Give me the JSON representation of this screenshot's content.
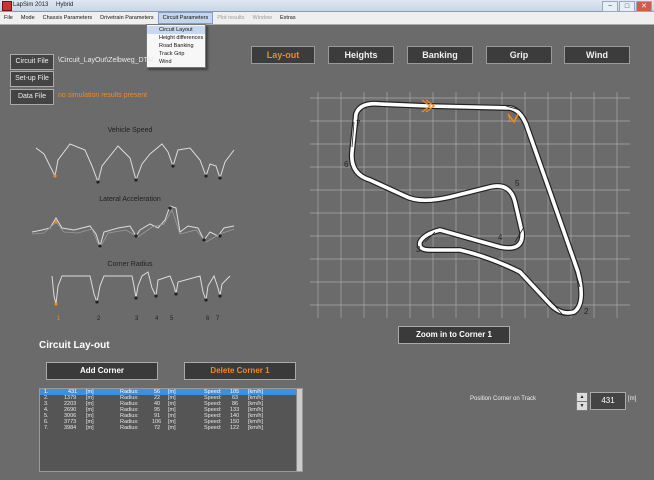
{
  "window": {
    "app_title": "LapSim 2013",
    "doc_title": "Hybrid",
    "minimize": "−",
    "maximize": "□",
    "close": "✕"
  },
  "menu": {
    "items": [
      {
        "label": "File",
        "state": "normal"
      },
      {
        "label": "Mode",
        "state": "normal"
      },
      {
        "label": "Chassis Parameters",
        "state": "normal"
      },
      {
        "label": "Drivetrain Parameters",
        "state": "normal"
      },
      {
        "label": "Circuit Parameters",
        "state": "active"
      },
      {
        "label": "Plot results",
        "state": "disabled"
      },
      {
        "label": "Window",
        "state": "disabled"
      },
      {
        "label": "Extras",
        "state": "normal"
      }
    ],
    "dropdown": [
      "Circuit Layout",
      "Height differences",
      "Road Banking",
      "Track Grip",
      "Wind"
    ],
    "dropdown_selected": 0
  },
  "files": {
    "circuit_btn": "Circuit File",
    "circuit_path": "\\Circuit_LayOut\\Zelbweg_DTM",
    "setup_btn": "Set-up File",
    "data_btn": "Data File",
    "data_status": "no simulation results present"
  },
  "tabs": [
    {
      "label": "Lay-out",
      "active": true
    },
    {
      "label": "Heights",
      "active": false
    },
    {
      "label": "Banking",
      "active": false
    },
    {
      "label": "Grip",
      "active": false
    },
    {
      "label": "Wind",
      "active": false
    }
  ],
  "charts": {
    "speed_title": "Vehicle Speed",
    "lat_title": "Lateral Acceleration",
    "radius_title": "Corner Radius",
    "corner_labels": [
      "1",
      "2",
      "3",
      "4",
      "5",
      "6",
      "7"
    ]
  },
  "track": {
    "corner_numbers": [
      "1",
      "2",
      "3",
      "4",
      "5",
      "6",
      "7"
    ],
    "line_color": "#ffffff",
    "edge_color": "#222222",
    "highlight_color": "#f08a1e"
  },
  "zoom_btn": "Zoom in to Corner 1",
  "section_title": "Circuit Lay-out",
  "add_corner": "Add Corner",
  "delete_corner": "Delete Corner 1",
  "corners": [
    {
      "n": "1.",
      "pos": "431",
      "pu": "[m]",
      "rl": "Radius:",
      "r": "56",
      "ru": "[m]",
      "sl": "Speed:",
      "s": "105",
      "su": "[km/h]"
    },
    {
      "n": "2.",
      "pos": "1379",
      "pu": "[m]",
      "rl": "Radius:",
      "r": "22",
      "ru": "[m]",
      "sl": "Speed:",
      "s": "63",
      "su": "[km/h]"
    },
    {
      "n": "3.",
      "pos": "2203",
      "pu": "[m]",
      "rl": "Radius:",
      "r": "40",
      "ru": "[m]",
      "sl": "Speed:",
      "s": "86",
      "su": "[km/h]"
    },
    {
      "n": "4.",
      "pos": "2690",
      "pu": "[m]",
      "rl": "Radius:",
      "r": "95",
      "ru": "[m]",
      "sl": "Speed:",
      "s": "133",
      "su": "[km/h]"
    },
    {
      "n": "5.",
      "pos": "3006",
      "pu": "[m]",
      "rl": "Radius:",
      "r": "91",
      "ru": "[m]",
      "sl": "Speed:",
      "s": "140",
      "su": "[km/h]"
    },
    {
      "n": "6.",
      "pos": "3773",
      "pu": "[m]",
      "rl": "Radius:",
      "r": "106",
      "ru": "[m]",
      "sl": "Speed:",
      "s": "150",
      "su": "[km/h]"
    },
    {
      "n": "7.",
      "pos": "3984",
      "pu": "[m]",
      "rl": "Radius:",
      "r": "72",
      "ru": "[m]",
      "sl": "Speed:",
      "s": "122",
      "su": "[km/h]"
    }
  ],
  "position": {
    "label": "Position Corner on Track",
    "value": "431",
    "unit": "[m]",
    "up": "▲",
    "down": "▼"
  },
  "colors": {
    "accent": "#f08a1e",
    "background": "#6b6b6b",
    "selection": "#3d8fe0"
  }
}
